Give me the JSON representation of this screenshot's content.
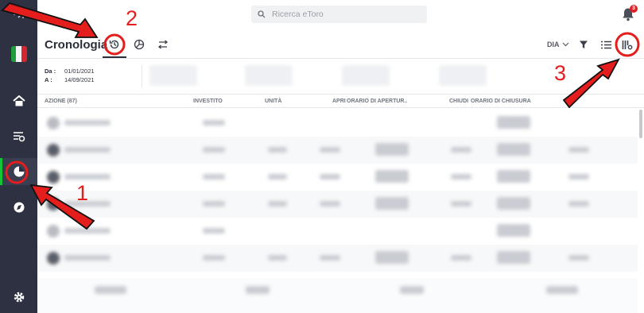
{
  "search": {
    "placeholder": "Ricerca eToro"
  },
  "notifications": {
    "count": "3"
  },
  "header": {
    "title": "Cronologia",
    "view_label": "DIA"
  },
  "dates": {
    "from_label": "Da :",
    "from_value": "01/01/2021",
    "to_label": "A :",
    "to_value": "14/09/2021"
  },
  "table": {
    "columns": [
      "AZIONE (87)",
      "INVESTITO",
      "UNITÀ",
      "APRI",
      "ORARIO DI APERTUR..",
      "CHIUDI",
      "ORARIO DI CHIUSURA"
    ]
  },
  "annotations": {
    "labels": [
      "1",
      "2",
      "3"
    ],
    "color": "#e41d1d"
  },
  "colors": {
    "sidebar": "#2e3141",
    "accent": "#13c636",
    "badge": "#e02027"
  }
}
